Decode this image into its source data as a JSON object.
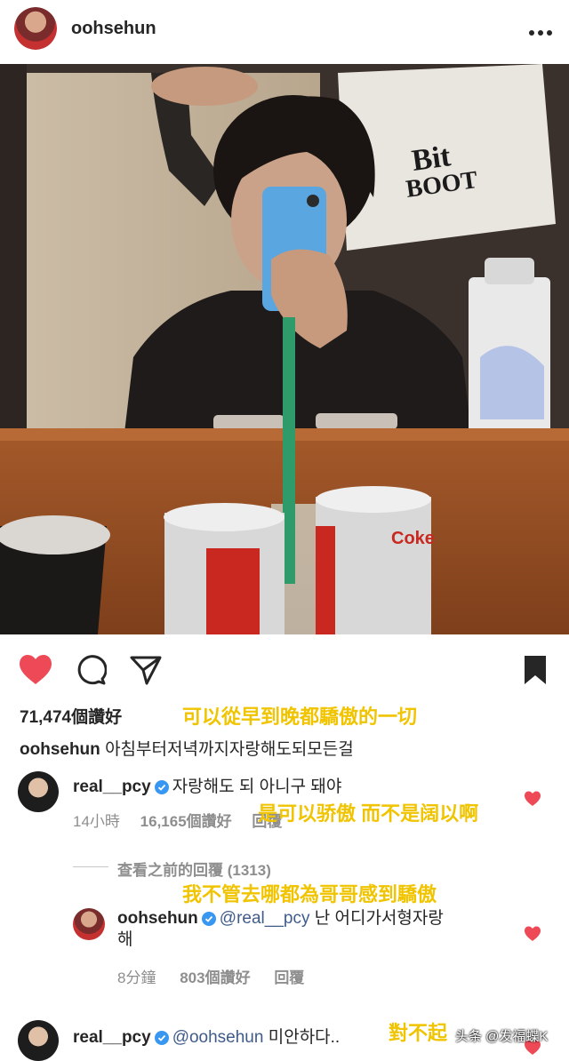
{
  "header": {
    "username": "oohsehun"
  },
  "post": {
    "likes": "71,474個讚好",
    "caption_user": "oohsehun",
    "caption_text": "아침부터저녁까지자랑해도되모든걸",
    "caption_overlay_zh": "可以從早到晚都驕傲的一切"
  },
  "photo": {
    "shirt_text_1": "Bit",
    "shirt_text_2": "BOOT",
    "can_text": "Coke"
  },
  "comments": [
    {
      "user": "real__pcy",
      "text": "자랑해도 되 아니구 돼야",
      "time": "14小時",
      "likes": "16,165個讚好",
      "reply": "回覆",
      "overlay": "是可以骄傲 而不是阔以啊"
    },
    {
      "view_previous": "查看之前的回覆 (1313)",
      "overlay": "我不管去哪都為哥哥感到驕傲",
      "user": "oohsehun",
      "mention": "@real__pcy",
      "text": "난 어디가서형자랑",
      "text2": "해",
      "time": "8分鐘",
      "likes": "803個讚好",
      "reply": "回覆"
    },
    {
      "user": "real__pcy",
      "mention": "@oohsehun",
      "text": "미안하다..",
      "overlay": "對不起"
    }
  ],
  "watermark": "头条 @发福蝶K",
  "colors": {
    "like_red": "#ed4956",
    "overlay_yellow": "#f0c400",
    "verified_blue": "#3897f0"
  }
}
